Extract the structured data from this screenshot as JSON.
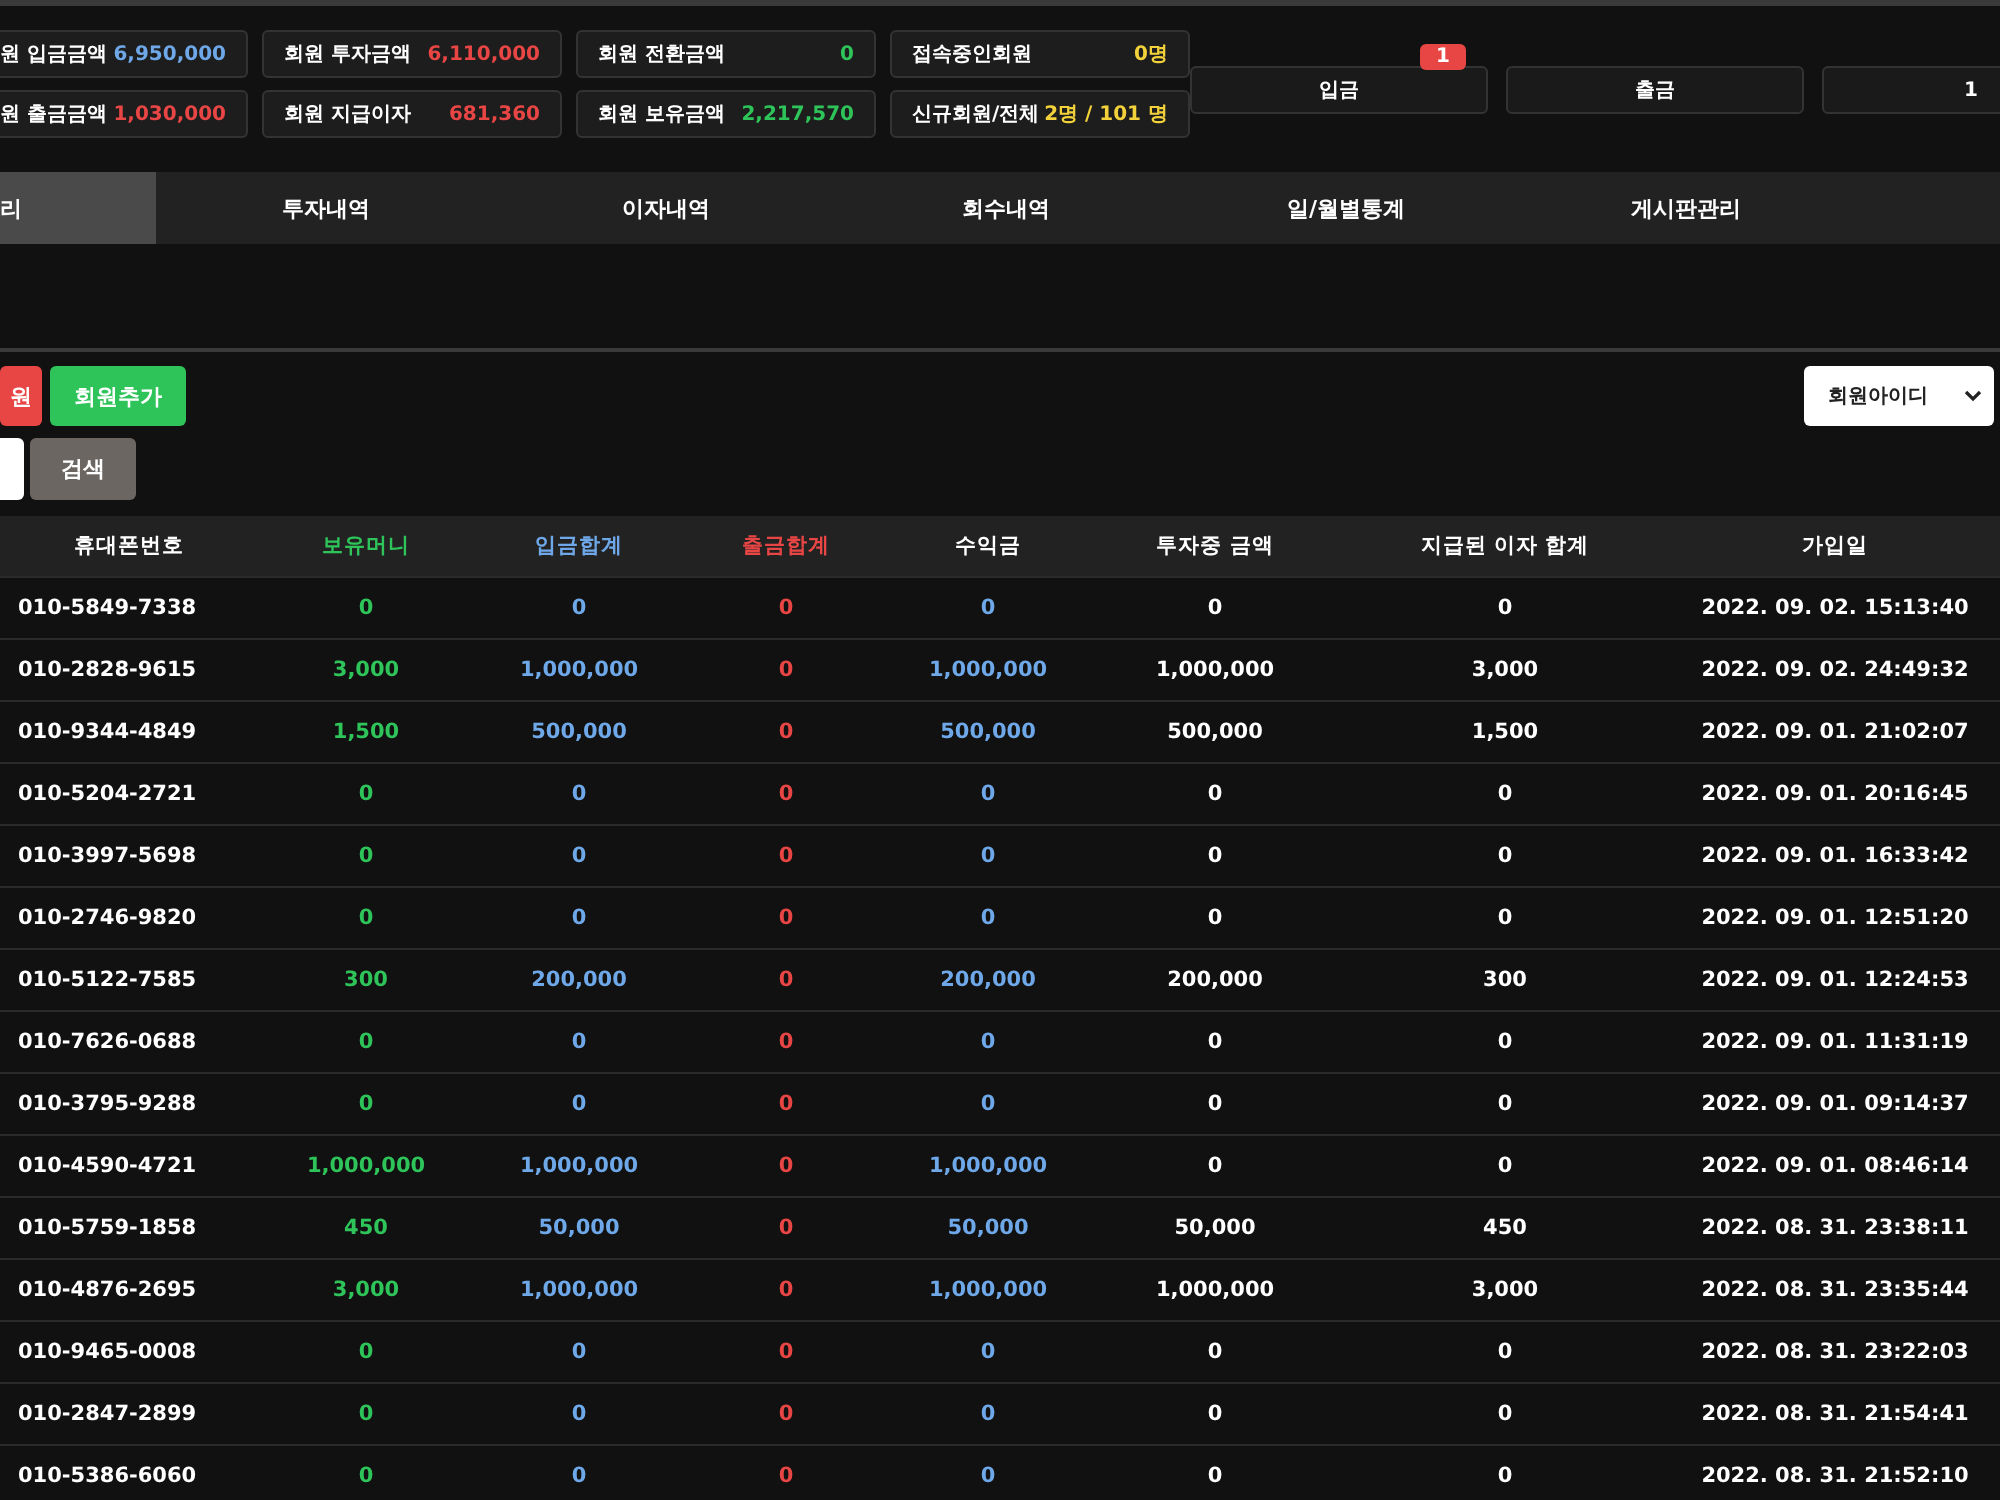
{
  "stats": [
    {
      "label": "원 입금금액",
      "value": "6,950,000",
      "color": "#6fa8e8"
    },
    {
      "label": "회원 투자금액",
      "value": "6,110,000",
      "color": "#e84545"
    },
    {
      "label": "회원 전환금액",
      "value": "0",
      "color": "#2ec45a"
    },
    {
      "label": "접속중인회원",
      "value": "0명",
      "color": "#f2d13a"
    },
    {
      "label": "원 출금금액",
      "value": "1,030,000",
      "color": "#e84545"
    },
    {
      "label": "회원 지급이자",
      "value": "681,360",
      "color": "#e84545"
    },
    {
      "label": "회원 보유금액",
      "value": "2,217,570",
      "color": "#2ec45a"
    },
    {
      "label": "신규회원/전체",
      "value": "2명 / 101 명",
      "color": "#f2d13a"
    }
  ],
  "quick_buttons": [
    {
      "label": "입금",
      "badge": "1"
    },
    {
      "label": "출금"
    },
    {
      "label": "1"
    }
  ],
  "tabs": [
    {
      "label": "리",
      "selected": true
    },
    {
      "label": "투자내역",
      "selected": false
    },
    {
      "label": "이자내역",
      "selected": false
    },
    {
      "label": "회수내역",
      "selected": false
    },
    {
      "label": "일/월별통계",
      "selected": false
    },
    {
      "label": "게시판관리",
      "selected": false
    }
  ],
  "actions": [
    {
      "label": "원",
      "kind": "danger"
    },
    {
      "label": "회원추가",
      "kind": "success"
    }
  ],
  "search_select": {
    "value": "회원아이디"
  },
  "search_button": "검색",
  "table": {
    "columns": [
      {
        "label": "휴대폰번호",
        "color": "#ffffff"
      },
      {
        "label": "보유머니",
        "color": "#2ec45a"
      },
      {
        "label": "입금합계",
        "color": "#6fa8e8"
      },
      {
        "label": "출금합계",
        "color": "#e84545"
      },
      {
        "label": "수익금",
        "color": "#ffffff"
      },
      {
        "label": "투자중 금액",
        "color": "#ffffff"
      },
      {
        "label": "지급된 이자 합계",
        "color": "#ffffff"
      },
      {
        "label": "가입일",
        "color": "#ffffff"
      }
    ],
    "rows": [
      [
        "010-5849-7338",
        "0",
        "0",
        "0",
        "0",
        "0",
        "0",
        "2022. 09. 02. 15:13:40"
      ],
      [
        "010-2828-9615",
        "3,000",
        "1,000,000",
        "0",
        "1,000,000",
        "1,000,000",
        "3,000",
        "2022. 09. 02. 24:49:32"
      ],
      [
        "010-9344-4849",
        "1,500",
        "500,000",
        "0",
        "500,000",
        "500,000",
        "1,500",
        "2022. 09. 01. 21:02:07"
      ],
      [
        "010-5204-2721",
        "0",
        "0",
        "0",
        "0",
        "0",
        "0",
        "2022. 09. 01. 20:16:45"
      ],
      [
        "010-3997-5698",
        "0",
        "0",
        "0",
        "0",
        "0",
        "0",
        "2022. 09. 01. 16:33:42"
      ],
      [
        "010-2746-9820",
        "0",
        "0",
        "0",
        "0",
        "0",
        "0",
        "2022. 09. 01. 12:51:20"
      ],
      [
        "010-5122-7585",
        "300",
        "200,000",
        "0",
        "200,000",
        "200,000",
        "300",
        "2022. 09. 01. 12:24:53"
      ],
      [
        "010-7626-0688",
        "0",
        "0",
        "0",
        "0",
        "0",
        "0",
        "2022. 09. 01. 11:31:19"
      ],
      [
        "010-3795-9288",
        "0",
        "0",
        "0",
        "0",
        "0",
        "0",
        "2022. 09. 01. 09:14:37"
      ],
      [
        "010-4590-4721",
        "1,000,000",
        "1,000,000",
        "0",
        "1,000,000",
        "0",
        "0",
        "2022. 09. 01. 08:46:14"
      ],
      [
        "010-5759-1858",
        "450",
        "50,000",
        "0",
        "50,000",
        "50,000",
        "450",
        "2022. 08. 31. 23:38:11"
      ],
      [
        "010-4876-2695",
        "3,000",
        "1,000,000",
        "0",
        "1,000,000",
        "1,000,000",
        "3,000",
        "2022. 08. 31. 23:35:44"
      ],
      [
        "010-9465-0008",
        "0",
        "0",
        "0",
        "0",
        "0",
        "0",
        "2022. 08. 31. 23:22:03"
      ],
      [
        "010-2847-2899",
        "0",
        "0",
        "0",
        "0",
        "0",
        "0",
        "2022. 08. 31. 21:54:41"
      ],
      [
        "010-5386-6060",
        "0",
        "0",
        "0",
        "0",
        "0",
        "0",
        "2022. 08. 31. 21:52:10"
      ]
    ]
  }
}
